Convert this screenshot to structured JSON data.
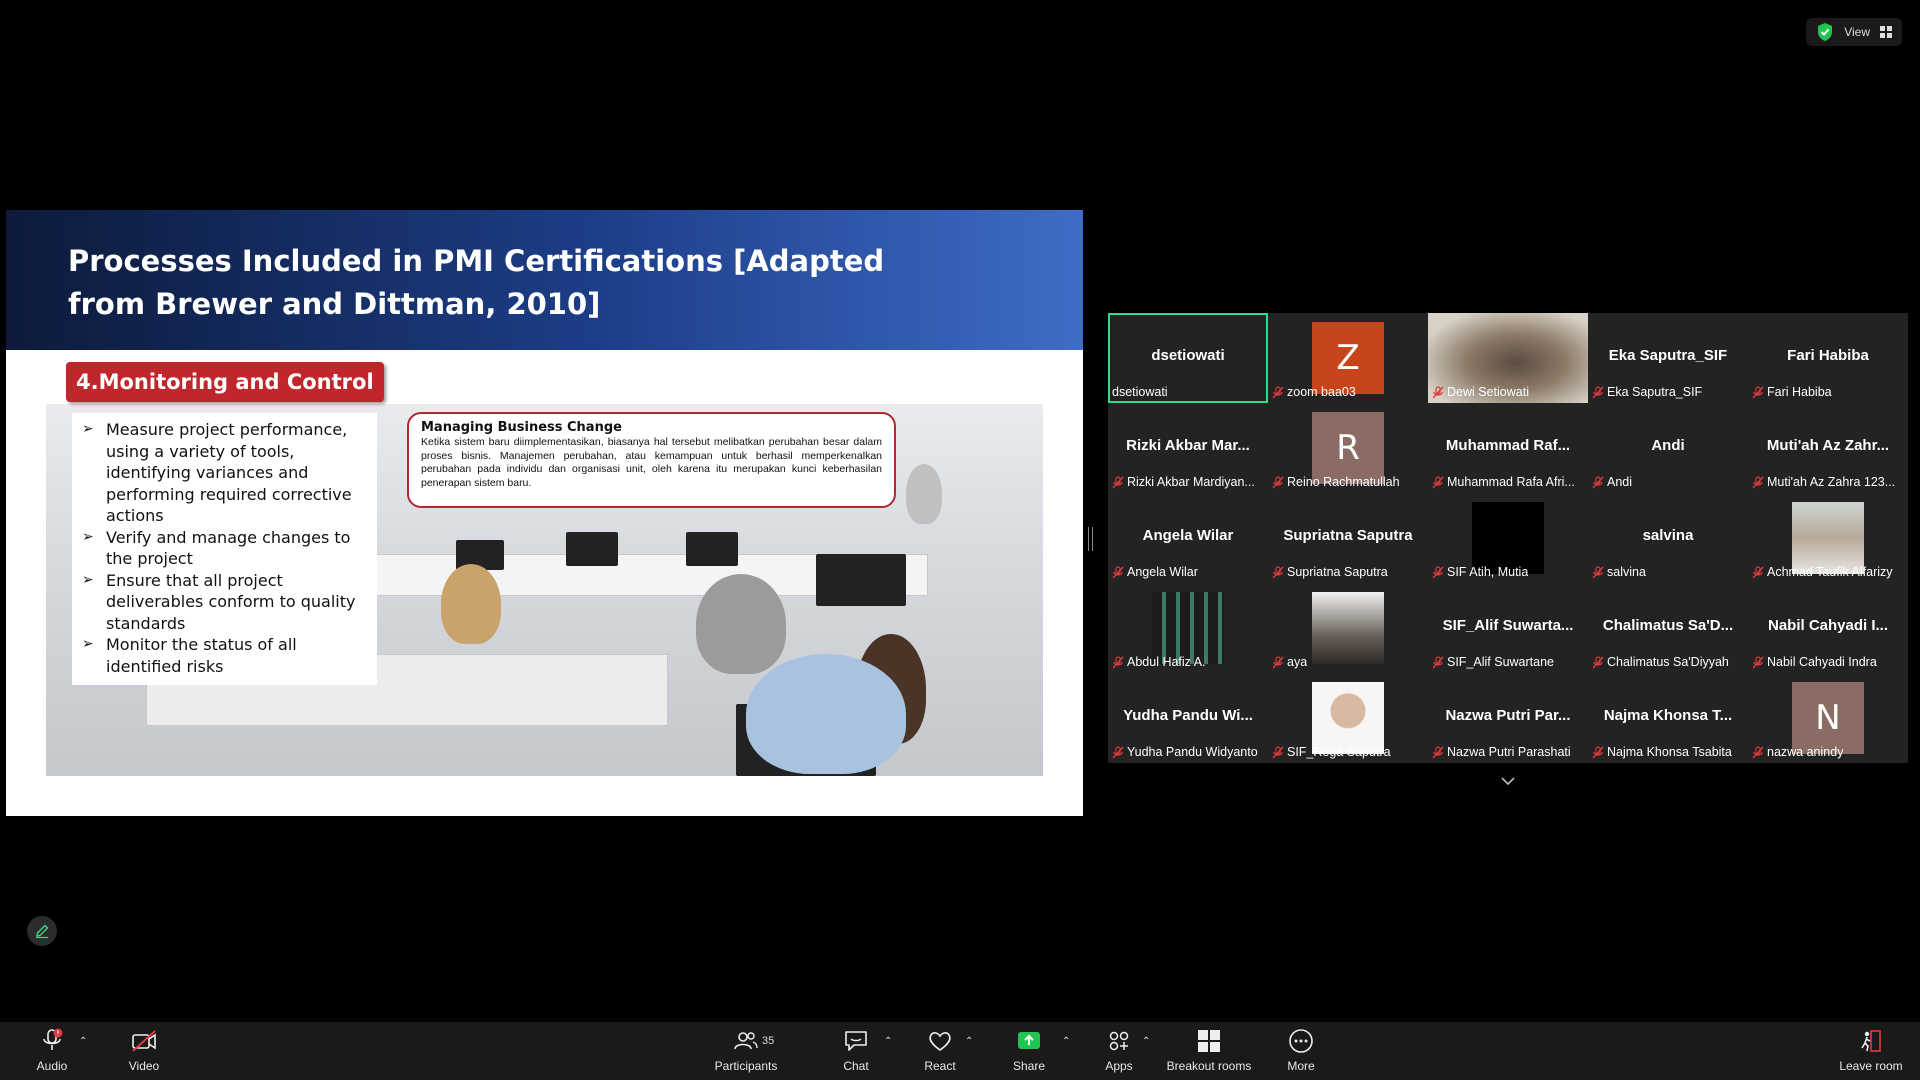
{
  "top_right": {
    "view_label": "View"
  },
  "slide": {
    "title": "Processes Included in PMI Certifications [Adapted from Brewer and Dittman, 2010]",
    "section": "4.Monitoring and Control",
    "bullets": [
      "Measure project performance, using a variety of tools, identifying variances and performing required corrective actions",
      "Verify and manage changes to the project",
      "Ensure that all project deliverables conform to quality standards",
      "Monitor the status of all identified risks"
    ],
    "callout_title": "Managing Business Change",
    "callout_text": "Ketika sistem baru diimplementasikan, biasanya hal tersebut melibatkan perubahan besar dalam proses bisnis. Manajemen perubahan, atau kemampuan untuk berhasil memperkenalkan perubahan pada individu dan organisasi unit, oleh karena itu merupakan kunci keberhasilan penerapan sistem baru."
  },
  "participants": [
    {
      "display": "dsetiowati",
      "label": "dsetiowati",
      "kind": "name",
      "muted": false,
      "active": true
    },
    {
      "display": "Z",
      "label": "zoom baa03",
      "kind": "letter",
      "color": "#c8451c",
      "muted": true
    },
    {
      "display": "",
      "label": "Dewi Setiowati",
      "kind": "video",
      "muted": true
    },
    {
      "display": "Eka Saputra_SIF",
      "label": "Eka Saputra_SIF",
      "kind": "name",
      "muted": true
    },
    {
      "display": "Fari Habiba",
      "label": "Fari Habiba",
      "kind": "name",
      "muted": true
    },
    {
      "display": "Rizki Akbar Mar...",
      "label": "Rizki Akbar Mardiyan...",
      "kind": "name",
      "muted": true
    },
    {
      "display": "R",
      "label": "Reino Rachmatullah",
      "kind": "letter",
      "color": "#8a6c64",
      "muted": true
    },
    {
      "display": "Muhammad Raf...",
      "label": "Muhammad Rafa Afri...",
      "kind": "name",
      "muted": true
    },
    {
      "display": "Andi",
      "label": "Andi",
      "kind": "name",
      "muted": true
    },
    {
      "display": "Muti'ah Az Zahr...",
      "label": "Muti'ah Az Zahra 123...",
      "kind": "name",
      "muted": true
    },
    {
      "display": "Angela Wilar",
      "label": "Angela Wilar",
      "kind": "name",
      "muted": true
    },
    {
      "display": "Supriatna Saputra",
      "label": "Supriatna Saputra",
      "kind": "name",
      "muted": true
    },
    {
      "display": "",
      "label": "SIF Atih, Mutia",
      "kind": "black",
      "muted": true
    },
    {
      "display": "salvina",
      "label": "salvina",
      "kind": "name",
      "muted": true
    },
    {
      "display": "",
      "label": "Achmad Taufik Alfarizy",
      "kind": "photo",
      "muted": true
    },
    {
      "display": "",
      "label": "Abdul Hafiz A.",
      "kind": "photo-dark",
      "muted": true
    },
    {
      "display": "",
      "label": "aya",
      "kind": "photo-gray",
      "muted": true
    },
    {
      "display": "SIF_Alif Suwarta...",
      "label": "SIF_Alif Suwartane",
      "kind": "name",
      "muted": true
    },
    {
      "display": "Chalimatus Sa'D...",
      "label": "Chalimatus Sa'Diyyah",
      "kind": "name",
      "muted": true
    },
    {
      "display": "Nabil Cahyadi I...",
      "label": "Nabil Cahyadi Indra",
      "kind": "name",
      "muted": true
    },
    {
      "display": "Yudha Pandu Wi...",
      "label": "Yudha Pandu Widyanto",
      "kind": "name",
      "muted": true
    },
    {
      "display": "",
      "label": "SIF_Rega Saputra",
      "kind": "photo-white",
      "muted": true
    },
    {
      "display": "Nazwa Putri Par...",
      "label": "Nazwa Putri Parashati",
      "kind": "name",
      "muted": true
    },
    {
      "display": "Najma Khonsa T...",
      "label": "Najma Khonsa Tsabita",
      "kind": "name",
      "muted": true
    },
    {
      "display": "N",
      "label": "nazwa anindy",
      "kind": "letter",
      "color": "#8a6c64",
      "muted": true
    }
  ],
  "toolbar": {
    "audio": "Audio",
    "video": "Video",
    "participants": "Participants",
    "participants_count": "35",
    "chat": "Chat",
    "react": "React",
    "share": "Share",
    "apps": "Apps",
    "breakout": "Breakout rooms",
    "more": "More",
    "leave": "Leave room"
  },
  "colors": {
    "active_border": "#2ddc8e",
    "share_green": "#23c552",
    "mute_red": "#e0383e"
  }
}
